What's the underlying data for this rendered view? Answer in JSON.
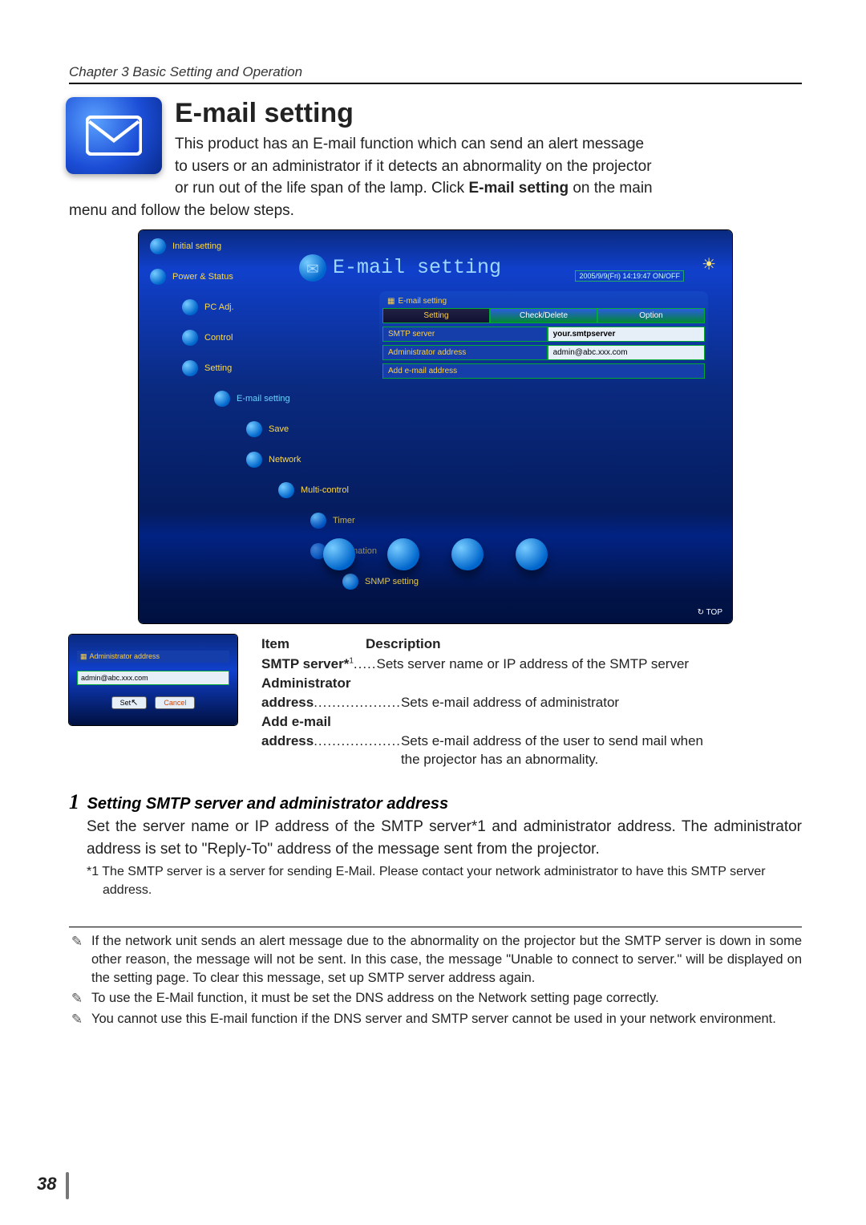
{
  "chapter": "Chapter 3 Basic Setting and Operation",
  "heading": "E-mail setting",
  "intro_line1": "This product has an E-mail function which can send an alert message",
  "intro_line2": "to users or an administrator if it detects an abnormality on the projector",
  "intro_line3_a": "or run out of the life span of the lamp. Click ",
  "intro_bold": "E-mail setting",
  "intro_line3_b": " on the main",
  "intro_line4": "menu and follow the below steps.",
  "shot": {
    "nav": {
      "initial": "Initial setting",
      "power": "Power & Status",
      "pcadj": "PC Adj.",
      "control": "Control",
      "setting": "Setting",
      "email": "E-mail setting",
      "save": "Save",
      "network": "Network",
      "multi": "Multi-control",
      "timer": "Timer",
      "info": "Information",
      "snmp": "SNMP setting"
    },
    "title": "E-mail setting",
    "status": "2005/9/9(Fri)   14:19:47  ON/OFF",
    "panel": {
      "title": "E-mail setting",
      "tabs": {
        "setting": "Setting",
        "check": "Check/Delete",
        "option": "Option"
      },
      "smtp_label": "SMTP server",
      "smtp_value": "your.smtpserver",
      "admin_label": "Administrator address",
      "admin_value": "admin@abc.xxx.com",
      "add_label": "Add e-mail address"
    },
    "top": "TOP"
  },
  "dialog": {
    "title": "Administrator address",
    "field": "admin@abc.xxx.com",
    "set": "Set",
    "cancel": "Cancel"
  },
  "table": {
    "h_item": "Item",
    "h_desc": "Description",
    "r1_label": "SMTP server*",
    "r1_sup": "1",
    "r1_dots": ".....",
    "r1_desc": "Sets server name or IP address of the SMTP server",
    "r2_label_a": "Administrator",
    "r2_label_b": "address",
    "r2_dots": "...................",
    "r2_desc": "Sets e-mail address of administrator",
    "r3_label_a": "Add e-mail",
    "r3_label_b": "address",
    "r3_dots": "...................",
    "r3_desc_a": "Sets e-mail address of the user to send mail when",
    "r3_desc_b": "the projector has an abnormality."
  },
  "section": {
    "num": "1",
    "title": "Setting SMTP server and administrator address",
    "body_a": "Set the server name or IP address of the SMTP server*",
    "body_sup": "1",
    "body_b": " and administrator address. The administrator address is set to \"Reply-To\" address of the message sent from the projector.",
    "foot": "*1 The SMTP server is a server for sending E-Mail. Please contact your network administrator to have this SMTP server address."
  },
  "notes": {
    "n1": "If the network unit sends an alert message due to the abnormality on the projector but the SMTP server is down in some other reason, the message will not be sent. In this case, the message \"Unable to connect to server.\" will be displayed on the setting page. To clear this message, set up SMTP server address again.",
    "n2": "To use the E-Mail function, it must be set the DNS address on the Network setting page correctly.",
    "n3": "You cannot use this E-mail function if the DNS server and SMTP server cannot be used in your network environment."
  },
  "page_number": "38"
}
